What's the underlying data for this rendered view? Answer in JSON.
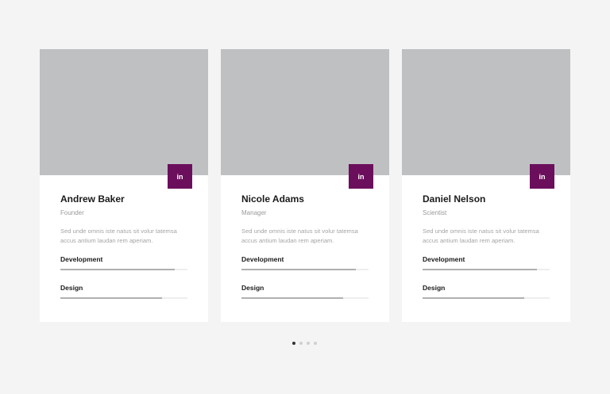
{
  "team": [
    {
      "name": "Andrew Baker",
      "role": "Founder",
      "description": "Sed unde omnis iste natus sit volur tatemsa accus antium laudan rem aperiam.",
      "social_label": "in",
      "skills": [
        {
          "label": "Development",
          "progress": 0.9
        },
        {
          "label": "Design",
          "progress": 0.8
        }
      ]
    },
    {
      "name": "Nicole Adams",
      "role": "Manager",
      "description": "Sed unde omnis iste natus sit volur tatemsa accus antium laudan rem aperiam.",
      "social_label": "in",
      "skills": [
        {
          "label": "Development",
          "progress": 0.9
        },
        {
          "label": "Design",
          "progress": 0.8
        }
      ]
    },
    {
      "name": "Daniel Nelson",
      "role": "Scientist",
      "description": "Sed unde omnis iste natus sit volur tatemsa accus antium laudan rem aperiam.",
      "social_label": "in",
      "skills": [
        {
          "label": "Development",
          "progress": 0.9
        },
        {
          "label": "Design",
          "progress": 0.8
        }
      ]
    }
  ],
  "pagination": {
    "count": 4,
    "active": 0
  },
  "colors": {
    "accent": "#6b0f5c",
    "photo_placeholder": "#bfc0c2",
    "page_background": "#f4f4f4",
    "progress_fill": "#b0b0b0"
  }
}
